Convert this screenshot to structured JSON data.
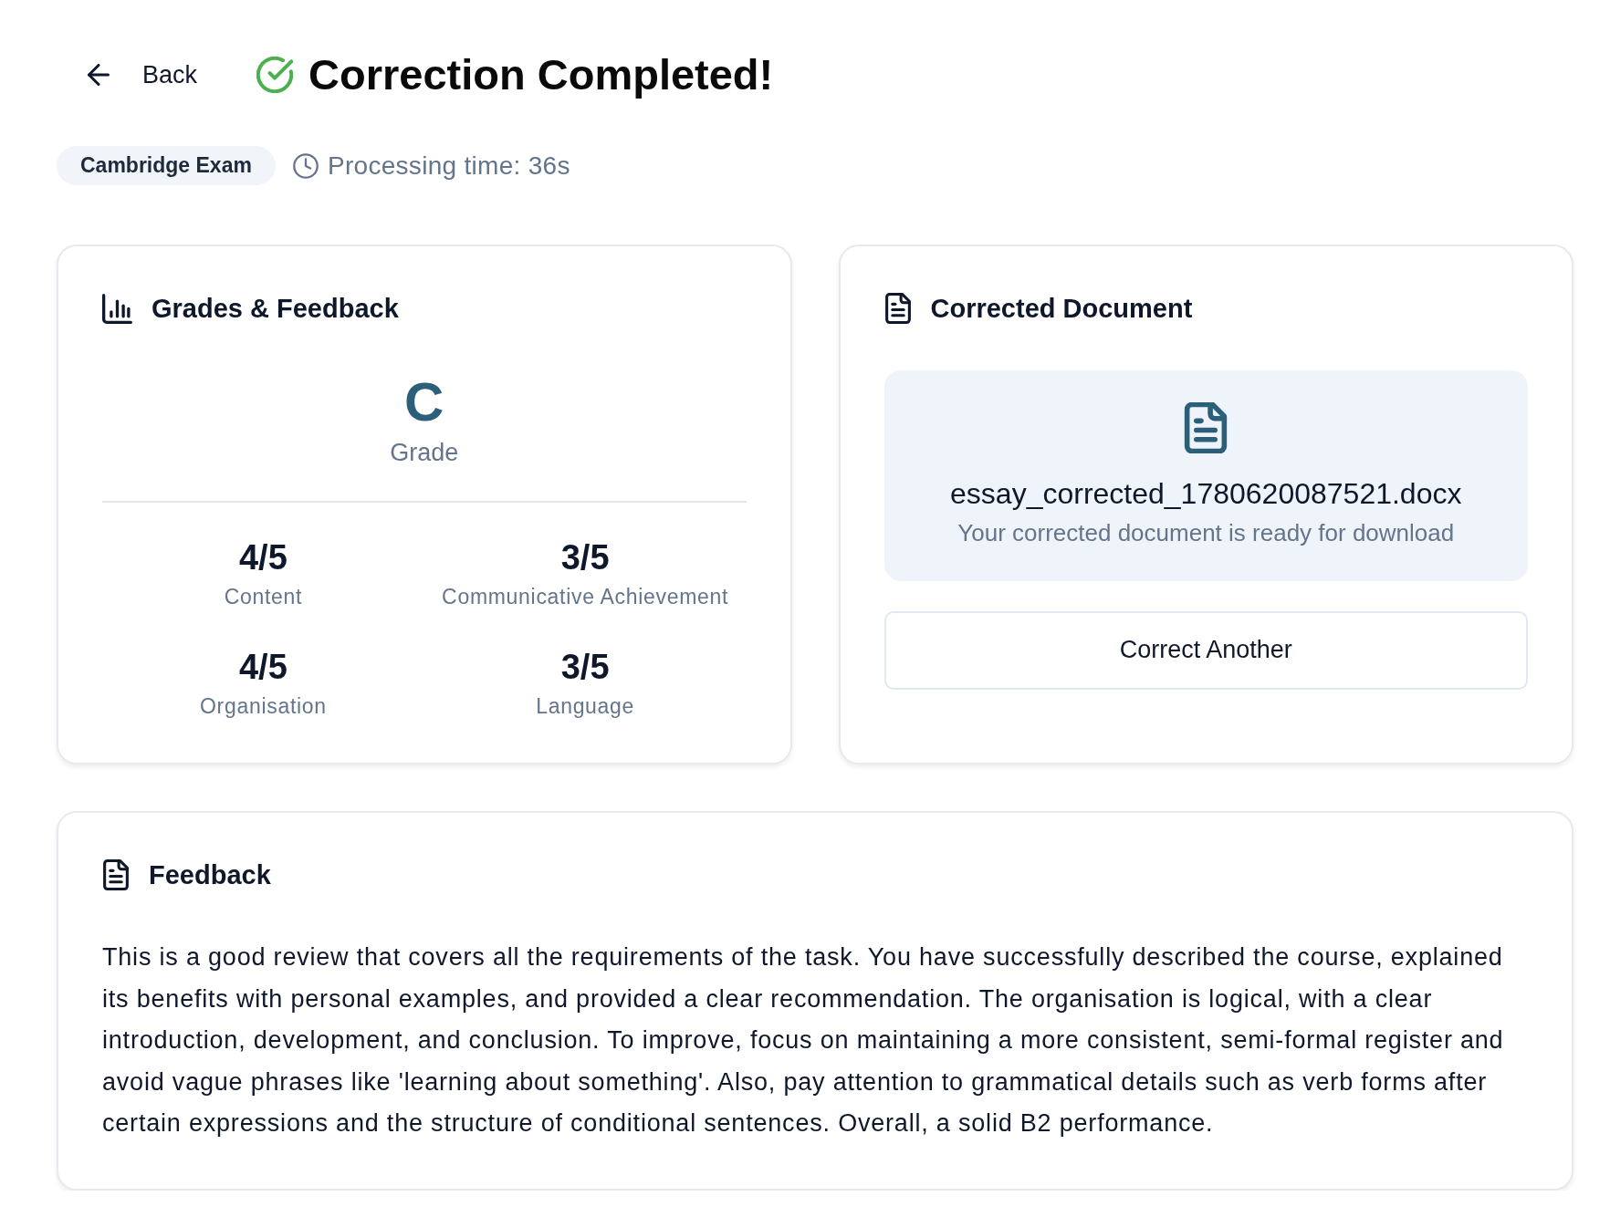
{
  "header": {
    "back_label": "Back",
    "title": "Correction Completed!"
  },
  "meta": {
    "exam_badge": "Cambridge Exam",
    "processing_time": "Processing time: 36s"
  },
  "grades_card": {
    "title": "Grades & Feedback",
    "grade": "C",
    "grade_label": "Grade",
    "scores": [
      {
        "value": "4/5",
        "label": "Content"
      },
      {
        "value": "3/5",
        "label": "Communicative Achievement"
      },
      {
        "value": "4/5",
        "label": "Organisation"
      },
      {
        "value": "3/5",
        "label": "Language"
      }
    ]
  },
  "document_card": {
    "title": "Corrected Document",
    "file_name": "essay_corrected_1780620087521.docx",
    "status": "Your corrected document is ready for download",
    "button": "Correct Another"
  },
  "feedback_card": {
    "title": "Feedback",
    "text": "This is a good review that covers all the requirements of the task. You have successfully described the course, explained its benefits with personal examples, and provided a clear recommendation. The organisation is logical, with a clear introduction, development, and conclusion. To improve, focus on maintaining a more consistent, semi-formal register and avoid vague phrases like 'learning about something'. Also, pay attention to grammatical details such as verb forms after certain expressions and the structure of conditional sentences. Overall, a solid B2 performance."
  }
}
